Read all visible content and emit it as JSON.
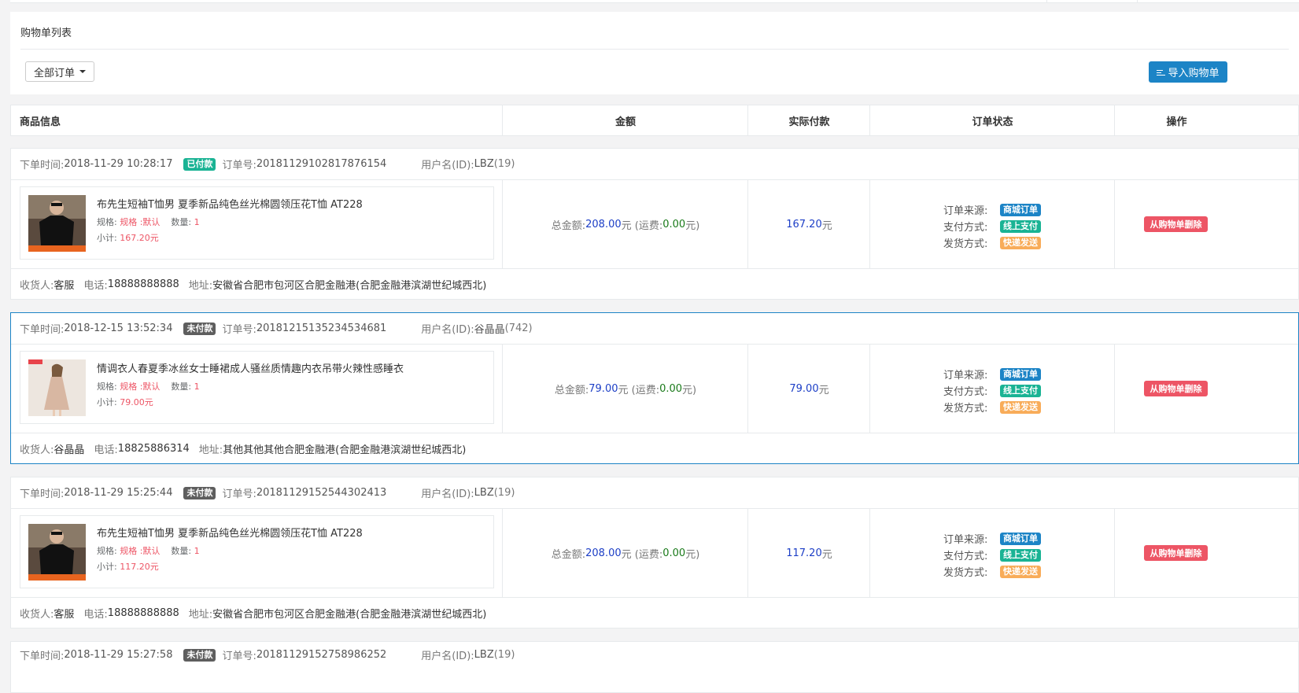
{
  "panel": {
    "title": "购物单列表",
    "filter_label": "全部订单",
    "import_label": "导入购物单"
  },
  "table": {
    "columns": [
      "商品信息",
      "金额",
      "实际付款",
      "订单状态",
      "操作"
    ]
  },
  "labels": {
    "order_time": "下单时间:",
    "order_no": "订单号:",
    "username": "用户名(ID):",
    "spec": "规格:",
    "qty": "数量:",
    "subtotal": "小计:",
    "total": "总金额:",
    "freight_open": "(运费:",
    "freight_close": "元)",
    "yuan": "元",
    "source": "订单来源:",
    "payment": "支付方式:",
    "shipping": "发货方式:",
    "receiver": "收货人:",
    "phone": "电话:",
    "address": "地址:",
    "delete": "从购物单删除"
  },
  "orders": [
    {
      "time": "2018-11-29 10:28:17",
      "status": "已付款",
      "status_color": "#1ab394",
      "order_no": "20181129102817876154",
      "user": "LBZ",
      "user_id": "(19)",
      "product_name": "布先生短袖T恤男 夏季新品纯色丝光棉圆领压花T恤 AT228",
      "spec": "规格 :默认",
      "qty": "1",
      "subtotal": "167.20元",
      "total": "208.00",
      "freight": "0.00",
      "paid": "167.20",
      "source": "商城订单",
      "payment": "线上支付",
      "shipping": "快递发送",
      "receiver": "客服",
      "phone": "18888888888",
      "address": "安徽省合肥市包河区合肥金融港(合肥金融港滨湖世纪城西北)",
      "thumb_icon": "tshirt-icon"
    },
    {
      "time": "2018-12-15 13:52:34",
      "status": "未付款",
      "status_color": "#5e5e5e",
      "order_no": "20181215135234534681",
      "user": "谷晶晶",
      "user_id": "(742)",
      "product_name": "情调衣人春夏季冰丝女士睡裙成人骚丝质情趣内衣吊带火辣性感睡衣",
      "spec": "规格 :默认",
      "qty": "1",
      "subtotal": "79.00元",
      "total": "79.00",
      "freight": "0.00",
      "paid": "79.00",
      "source": "商城订单",
      "payment": "线上支付",
      "shipping": "快递发送",
      "receiver": "谷晶晶",
      "phone": "18825886314",
      "address": "其他其他其他合肥金融港(合肥金融港滨湖世纪城西北)",
      "thumb_icon": "nightdress-icon"
    },
    {
      "time": "2018-11-29 15:25:44",
      "status": "未付款",
      "status_color": "#5e5e5e",
      "order_no": "20181129152544302413",
      "user": "LBZ",
      "user_id": "(19)",
      "product_name": "布先生短袖T恤男 夏季新品纯色丝光棉圆领压花T恤 AT228",
      "spec": "规格 :默认",
      "qty": "1",
      "subtotal": "117.20元",
      "total": "208.00",
      "freight": "0.00",
      "paid": "117.20",
      "source": "商城订单",
      "payment": "线上支付",
      "shipping": "快递发送",
      "receiver": "客服",
      "phone": "18888888888",
      "address": "安徽省合肥市包河区合肥金融港(合肥金融港滨湖世纪城西北)",
      "thumb_icon": "tshirt-icon"
    }
  ],
  "partial_order": {
    "time": "2018-11-29 15:27:58",
    "status": "未付款",
    "order_no": "20181129152758986252",
    "user": "LBZ",
    "user_id": "(19)"
  }
}
